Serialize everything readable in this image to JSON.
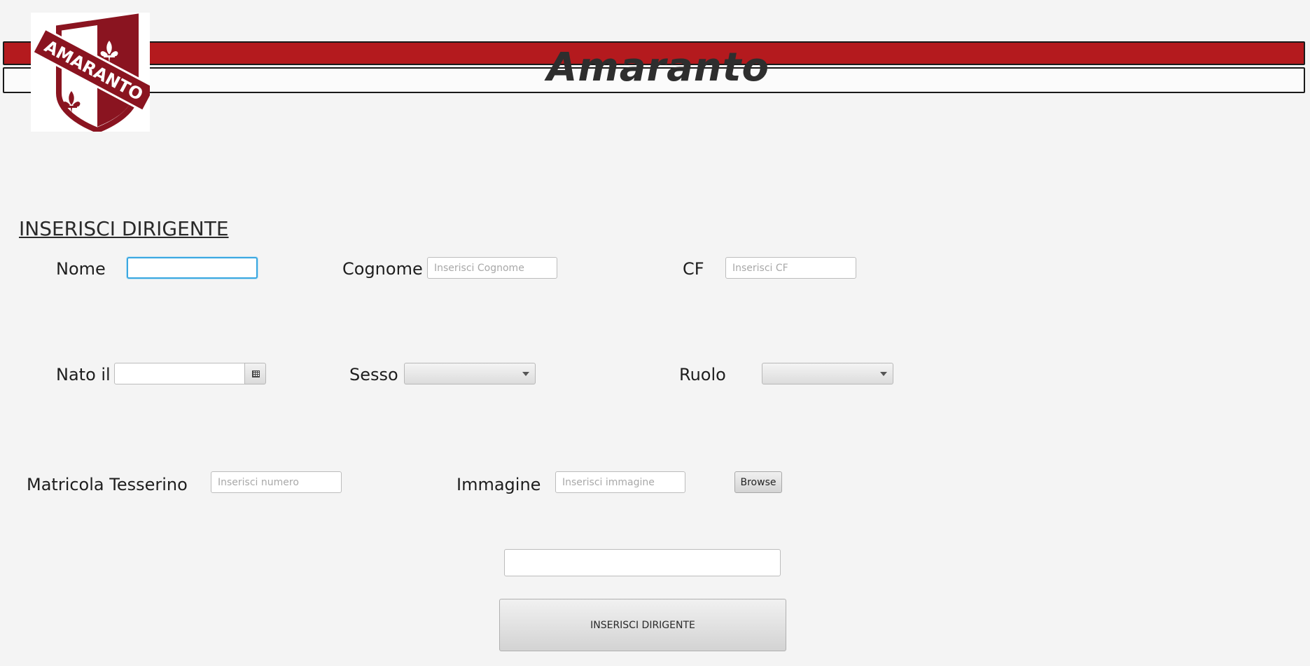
{
  "header": {
    "brand": "Amaranto",
    "logo_text": "AMARANTO",
    "colors": {
      "primary_red": "#b41a1e",
      "logo_maroon": "#8a1420"
    }
  },
  "form": {
    "title": "INSERISCI DIRIGENTE",
    "nome": {
      "label": "Nome",
      "value": "",
      "placeholder": ""
    },
    "cognome": {
      "label": "Cognome",
      "value": "",
      "placeholder": "Inserisci Cognome"
    },
    "cf": {
      "label": "CF",
      "value": "",
      "placeholder": "Inserisci CF"
    },
    "nato_il": {
      "label": "Nato il",
      "value": "",
      "icon": "calendar-icon"
    },
    "sesso": {
      "label": "Sesso",
      "selected": ""
    },
    "ruolo": {
      "label": "Ruolo",
      "selected": ""
    },
    "matricola": {
      "label": "Matricola Tesserino",
      "value": "",
      "placeholder": "Inserisci numero"
    },
    "immagine": {
      "label": "Immagine",
      "value": "",
      "placeholder": "Inserisci immagine"
    },
    "browse_label": "Browse",
    "result_value": "",
    "submit_label": "INSERISCI DIRIGENTE"
  }
}
